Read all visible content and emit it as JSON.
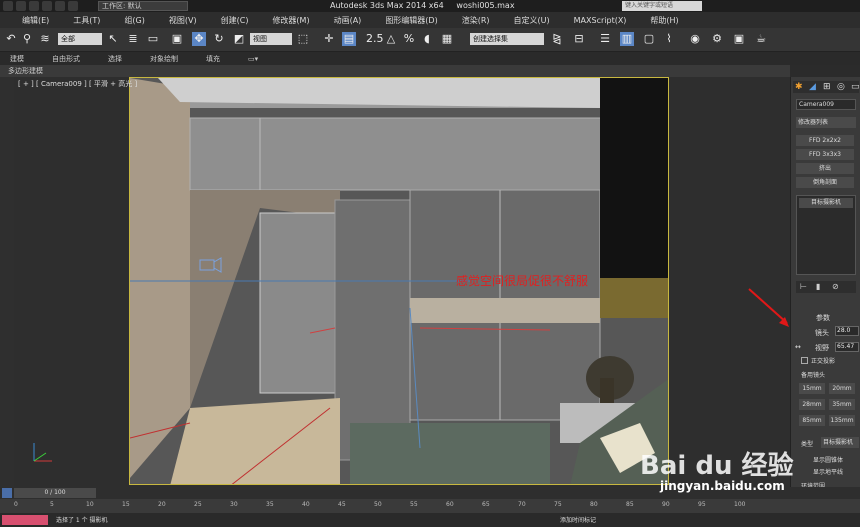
{
  "title": {
    "app": "Autodesk 3ds Max  2014 x64",
    "file": "woshi005.max",
    "workspace": "工作区: 默认",
    "search_placeholder": "键入关键字或短语"
  },
  "menu": [
    "编辑(E)",
    "工具(T)",
    "组(G)",
    "视图(V)",
    "创建(C)",
    "修改器(M)",
    "动画(A)",
    "图形编辑器(D)",
    "渲染(R)",
    "自定义(U)",
    "MAXScript(X)",
    "帮助(H)"
  ],
  "toolbar": {
    "filter": "全部",
    "coord": "视图",
    "selection_set": "创建选择集"
  },
  "ribbon": {
    "tabs": [
      "建模",
      "自由形式",
      "选择",
      "对象绘制",
      "填充"
    ],
    "sub": "多边形建模"
  },
  "viewport": {
    "label": "[ + ] [ Camera009 ] [ 平滑 + 高光 ]",
    "annotation": "感觉空间很局促很不舒服"
  },
  "panel": {
    "object_name": "Camera009",
    "modifier_list": "修改器列表",
    "mods": [
      "FFD 2x2x2",
      "FFD 3x3x3",
      "挤出",
      "倒角剖面"
    ],
    "stack_item": "目标摄影机",
    "params": "参数",
    "lens_label": "镜头",
    "lens_value": "28.0",
    "fov_label": "视野",
    "fov_value": "65.47",
    "ortho": "正交投影",
    "stock_lenses": "备用镜头",
    "lenses": [
      "15mm",
      "20mm",
      "28mm",
      "35mm",
      "85mm",
      "135mm"
    ],
    "type_label": "类型",
    "type_value": "目标摄影机",
    "show_cone": "显示圆锥体",
    "show_horizon": "显示地平线",
    "env_range": "环境范围",
    "display": "显示"
  },
  "timeline": {
    "frame": "0 / 100",
    "ticks": [
      "0",
      "5",
      "10",
      "15",
      "20",
      "25",
      "30",
      "35",
      "40",
      "45",
      "50",
      "55",
      "60",
      "65",
      "70",
      "75",
      "80",
      "85",
      "90",
      "95",
      "100"
    ]
  },
  "status": {
    "selected": "选择了 1 个 摄影机",
    "add_time_tag": "添加时间标记"
  },
  "watermark": {
    "brand": "Bai du 经验",
    "url": "jingyan.baidu.com"
  }
}
